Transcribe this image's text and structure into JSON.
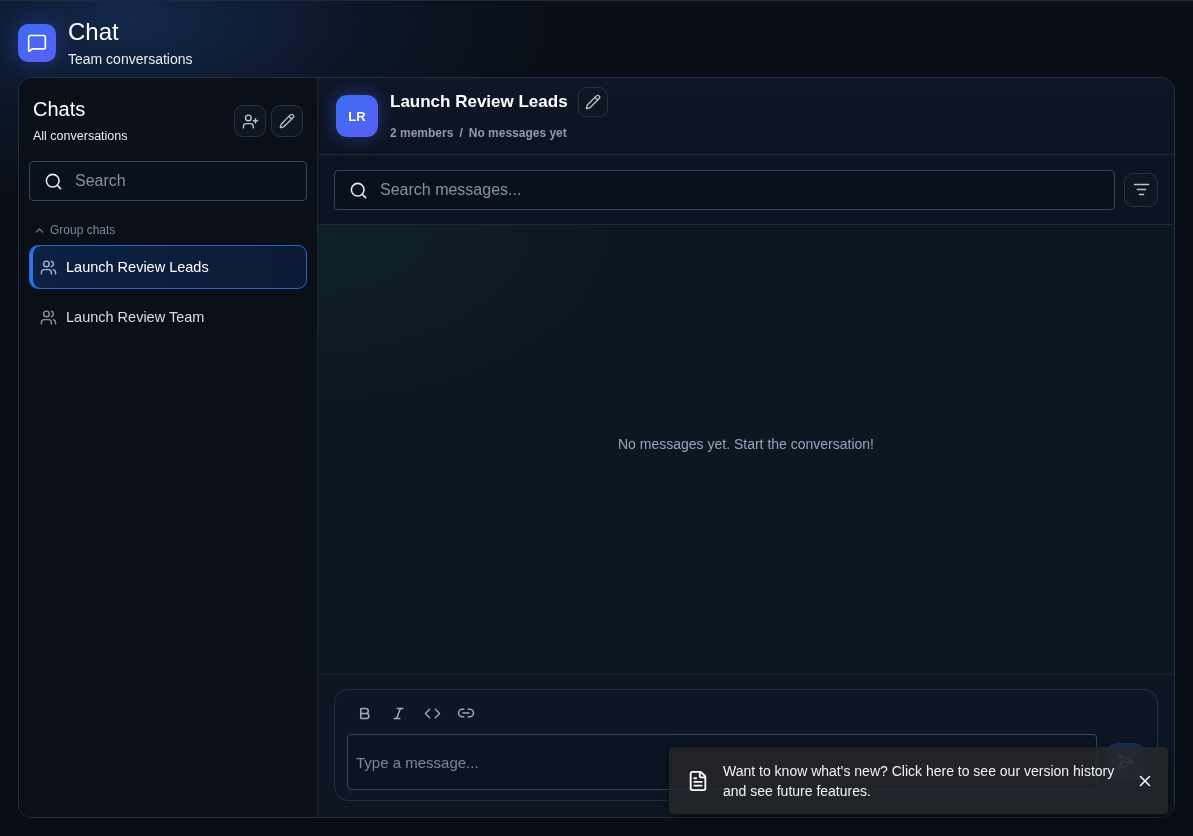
{
  "app": {
    "title": "Chat",
    "subtitle": "Team conversations"
  },
  "sidebar": {
    "title": "Chats",
    "subtitle": "All conversations",
    "search": {
      "placeholder": "Search"
    },
    "section": {
      "label": "Group chats",
      "expanded": true
    },
    "items": [
      {
        "label": "Launch Review Leads",
        "selected": true
      },
      {
        "label": "Launch Review Team",
        "selected": false
      }
    ]
  },
  "conversation": {
    "initials": "LR",
    "title": "Launch Review Leads",
    "members": "2 members",
    "separator": "/",
    "status": "No messages yet",
    "search": {
      "placeholder": "Search messages..."
    },
    "empty_message": "No messages yet. Start the conversation!",
    "composer": {
      "placeholder": "Type a message..."
    }
  },
  "toast": {
    "message": "Want to know what's new? Click here to see our version history and see future features."
  }
}
